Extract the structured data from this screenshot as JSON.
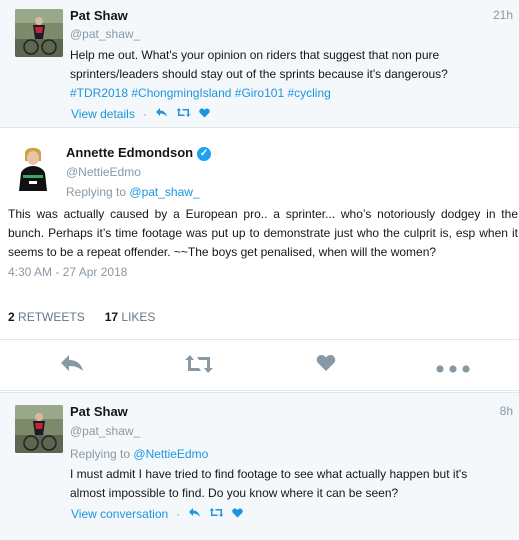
{
  "tweet1": {
    "name": "Pat Shaw",
    "handle": "@pat_shaw_",
    "time": "21h",
    "text": "Help me out. What's your opinion on riders that suggest that non pure sprinters/leaders should stay out of the sprints because it's dangerous?",
    "hashtags": "#TDR2018 #ChongmingIsland #Giro101 #cycling",
    "details_link": "View details",
    "sep": "·"
  },
  "tweet2": {
    "name": "Annette Edmondson",
    "handle": "@NettieEdmo",
    "replying_prefix": "Replying to",
    "replying_to": "@pat_shaw_",
    "text": "This was actually caused by a European pro.. a sprinter... who’s notoriously dodgey in the bunch. Perhaps it’s time footage was put up to demonstrate just who the culprit is, esp when it seems to be a repeat offender. ~~The boys get penalised, when will the women?",
    "date": "4:30 AM - 27 Apr 2018",
    "retweets_count": "2",
    "retweets_label": "RETWEETS",
    "likes_count": "17",
    "likes_label": "LIKES"
  },
  "tweet3": {
    "name": "Pat Shaw",
    "handle": "@pat_shaw_",
    "time": "8h",
    "replying_prefix": "Replying to",
    "replying_to": "@NettieEdmo",
    "text": "I must admit I have tried to find footage to see what actually happen but it's almost impossible to find. Do you know where it can be seen?",
    "conversation_link": "View conversation",
    "sep": "·"
  },
  "colors": {
    "accent": "#1b95e0",
    "muted": "#8899a6",
    "icon_grey": "#8899a6",
    "bg_alt": "#f5f8fa"
  }
}
